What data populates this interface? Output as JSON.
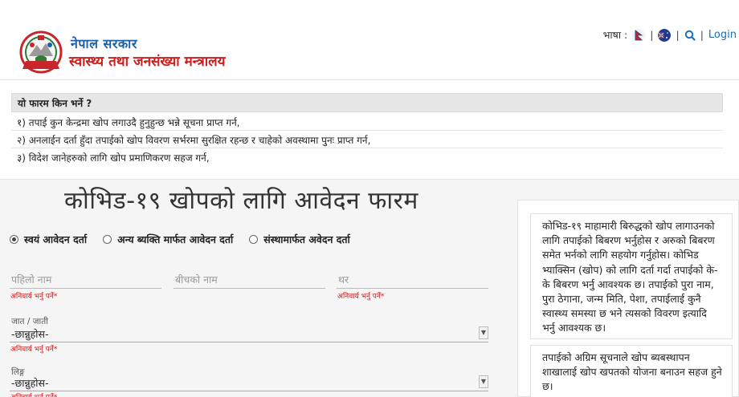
{
  "header": {
    "gov_name": "नेपाल सरकार",
    "ministry_name": "स्वास्थ्य तथा जनसंख्या मन्त्रालय",
    "language_label": "भाषा :",
    "login_label": "Login",
    "separator": "|"
  },
  "info": {
    "title": "यो फारम किन भर्ने ?",
    "lines": [
      "१) तपाई कुन केन्द्रमा खोप लगाउदै हुनुहुन्छ भन्ने सूचना प्राप्त गर्न,",
      "२) अनलाईन दर्ता हुँदा तपाईको खोप विवरण सर्भरमा सुरक्षित रहन्छ र चाहेको अवस्थामा पुनः प्राप्त गर्न,",
      "३) विदेश जानेहरुको लागि खोप प्रमाणिकरण सहज गर्न,"
    ]
  },
  "form": {
    "title": "कोभिड-१९ खोपको लागि आवेदन फारम",
    "registration_types": [
      {
        "label": "स्वयं आवेदन दर्ता",
        "checked": true
      },
      {
        "label": "अन्य ब्यक्ति मार्फत आवेदन दर्ता",
        "checked": false
      },
      {
        "label": "संस्थामार्फत अवेदन दर्ता",
        "checked": false
      }
    ],
    "first_name_placeholder": "पहिलो नाम",
    "middle_name_placeholder": "बीचको नाम",
    "last_name_placeholder": "थर",
    "required_text": "अनिवार्य भर्नु पर्ने*",
    "caste_label": "जात / जाती",
    "caste_value": "-छान्नुहोस-",
    "gender_label": "लिङ्ग",
    "gender_value": "-छान्नुहोस-"
  },
  "side_panel": {
    "card1": "कोभिड-१९ माहामारी बिरुद्धको खोप लागाउनको लागि तपाईको बिबरण भर्नुहोस र अरुको बिबरण समेत भर्नको लागि सहयोग गर्नुहोस। कोभिड भ्याक्सिन (खोप) को लागि दर्ता गर्दा तपाईको के-के बिबरण भर्नु आवश्यक छ। तपाईको पुरा नाम, पुरा ठेगाना, जन्म मिति, पेशा, तपाईलाई कुनै स्वास्थ्य समस्या छ भने त्यसको विवरण इत्यादि भर्नु आवश्यक छ।",
    "card2": "तपाईको अग्रिम सूचनाले खोप ब्यबस्थापन शाखालाई खोप खपतको योजना बनाउन सहज हुने छ।"
  },
  "colors": {
    "brand_blue": "#1a5fa8",
    "brand_red": "#d01b1b",
    "required_red": "#d01b1b"
  }
}
